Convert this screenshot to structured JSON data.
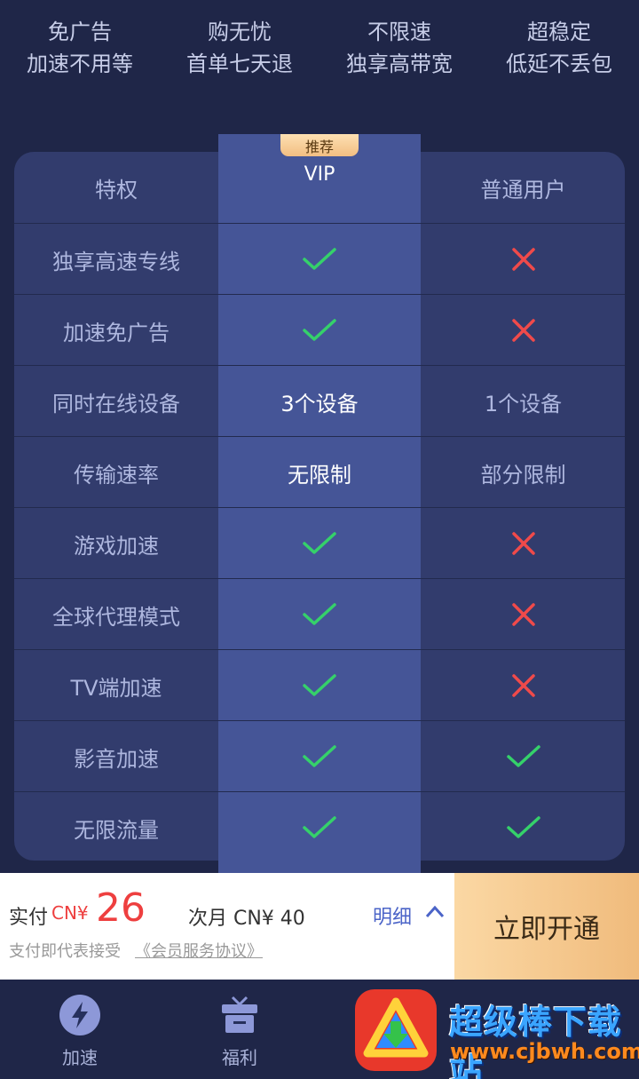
{
  "features": [
    {
      "title": "免广告",
      "subtitle": "加速不用等"
    },
    {
      "title": "购无忧",
      "subtitle": "首单七天退"
    },
    {
      "title": "不限速",
      "subtitle": "独享高带宽"
    },
    {
      "title": "超稳定",
      "subtitle": "低延不丢包"
    }
  ],
  "table": {
    "recommend_badge": "推荐",
    "header": {
      "privilege": "特权",
      "vip": "VIP",
      "normal": "普通用户"
    },
    "rows": [
      {
        "name": "独享高速专线",
        "vip": "check",
        "normal": "cross"
      },
      {
        "name": "加速免广告",
        "vip": "check",
        "normal": "cross"
      },
      {
        "name": "同时在线设备",
        "vip": "3个设备",
        "normal": "1个设备"
      },
      {
        "name": "传输速率",
        "vip": "无限制",
        "normal": "部分限制"
      },
      {
        "name": "游戏加速",
        "vip": "check",
        "normal": "cross"
      },
      {
        "name": "全球代理模式",
        "vip": "check",
        "normal": "cross"
      },
      {
        "name": "TV端加速",
        "vip": "check",
        "normal": "cross"
      },
      {
        "name": "影音加速",
        "vip": "check",
        "normal": "check"
      },
      {
        "name": "无限流量",
        "vip": "check",
        "normal": "check"
      }
    ],
    "icons": {
      "check": "check-icon",
      "cross": "cross-icon"
    },
    "colors": {
      "check": "#35d16a",
      "cross": "#f04a4a"
    }
  },
  "purchase": {
    "pay_label": "实付",
    "currency": "CN¥",
    "amount": "26",
    "next_month": "次月 CN¥ 40",
    "detail_label": "明细",
    "agree_text": "支付即代表接受",
    "agreement_link": "《会员服务协议》",
    "open_button": "立即开通"
  },
  "nav": [
    {
      "label": "加速",
      "icon": "lightning-icon"
    },
    {
      "label": "福利",
      "icon": "gift-icon"
    }
  ],
  "watermark": {
    "title": "超级棒下载站",
    "url": "www.cjbwh.com"
  }
}
